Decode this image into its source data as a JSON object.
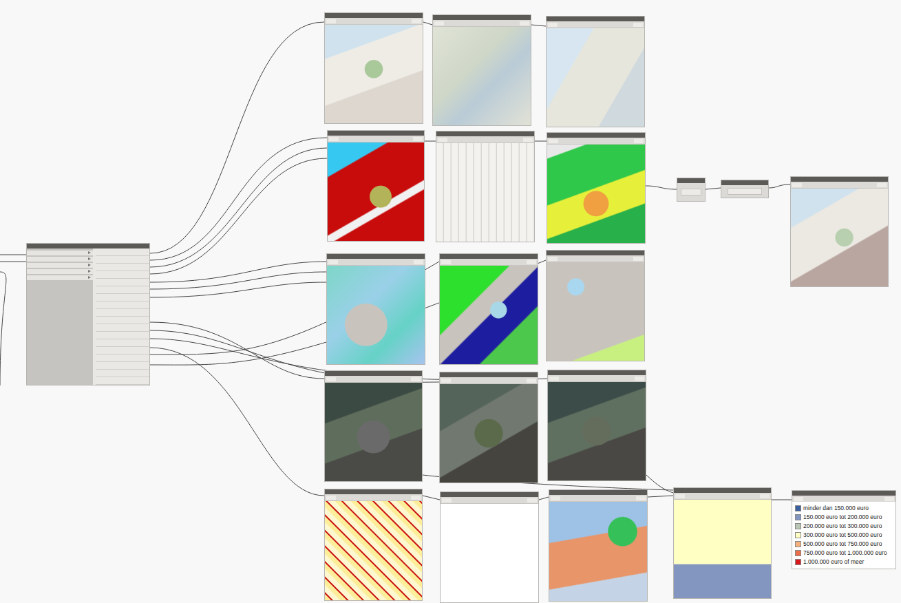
{
  "canvas": {
    "nodes": [
      {
        "kind": "source"
      },
      {
        "kind": "preview"
      },
      {
        "kind": "preview"
      },
      {
        "kind": "preview"
      },
      {
        "kind": "preview"
      },
      {
        "kind": "preview"
      },
      {
        "kind": "preview"
      },
      {
        "kind": "relay"
      },
      {
        "kind": "relay"
      },
      {
        "kind": "preview"
      },
      {
        "kind": "preview"
      },
      {
        "kind": "preview"
      },
      {
        "kind": "preview"
      },
      {
        "kind": "preview"
      },
      {
        "kind": "preview"
      },
      {
        "kind": "preview"
      },
      {
        "kind": "preview"
      },
      {
        "kind": "preview"
      },
      {
        "kind": "preview"
      },
      {
        "kind": "preview"
      },
      {
        "kind": "legend"
      }
    ]
  },
  "legend": {
    "items": [
      {
        "label": "minder dan 150.000 euro",
        "color": "#3b5f9e"
      },
      {
        "label": "150.000 euro tot 200.000 euro",
        "color": "#8396c0"
      },
      {
        "label": "200.000 euro tot 300.000 euro",
        "color": "#b9c6b3"
      },
      {
        "label": "300.000 euro tot 500.000 euro",
        "color": "#ffffc4"
      },
      {
        "label": "500.000 euro tot 750.000 euro",
        "color": "#f6b07e"
      },
      {
        "label": "750.000 euro tot 1.000.000 euro",
        "color": "#ea6e4c"
      },
      {
        "label": "1.000.000 euro of meer",
        "color": "#d7191c"
      }
    ]
  }
}
